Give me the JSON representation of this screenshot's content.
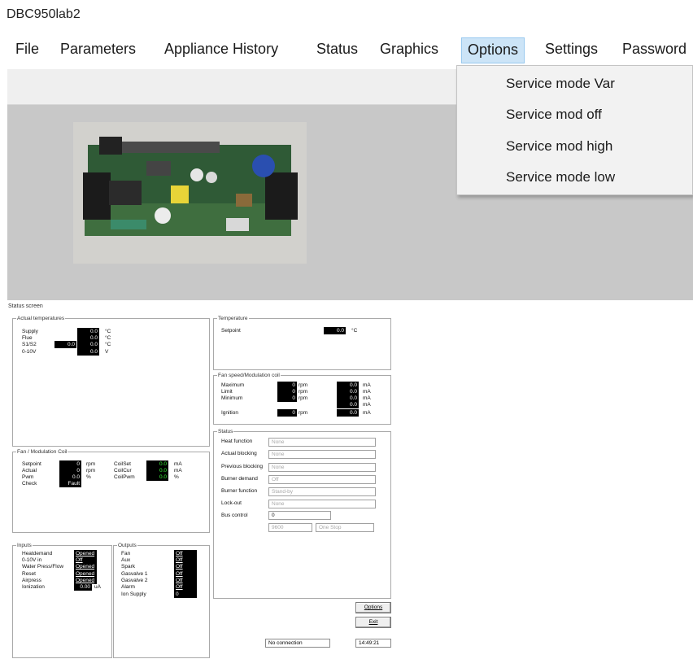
{
  "app": {
    "title": "DBC950lab2"
  },
  "menu": [
    "File",
    "Parameters",
    "Appliance History",
    "Status",
    "Graphics",
    "Options",
    "Settings",
    "Password"
  ],
  "options_menu": [
    "Service mode Var",
    "Service mod off",
    "Service mod high",
    "Service mode low"
  ],
  "status_screen": {
    "title": "Status screen",
    "actual_temperatures": {
      "label": "Actual temperatures",
      "rows": [
        {
          "label": "Supply",
          "value": "0.0",
          "unit": "°C"
        },
        {
          "label": "Flue",
          "value": "0.0",
          "unit": "°C"
        },
        {
          "label": "S1/S2",
          "value": "0.0",
          "unit": "°C",
          "extra": "0.0"
        },
        {
          "label": "0-10V",
          "value": "0.0",
          "unit": "V"
        }
      ]
    },
    "fan_modulation_coil": {
      "label": "Fan / Modulation Coil",
      "setpoint": {
        "label": "Setpoint",
        "value": "0",
        "unit": "rpm"
      },
      "actual": {
        "label": "Actual",
        "value": "0",
        "unit": "rpm"
      },
      "pwm": {
        "label": "Pwm",
        "value": "0.0",
        "unit": "%"
      },
      "check": {
        "label": "Check",
        "value": "Fault"
      },
      "coilset": {
        "label": "CoilSet",
        "value": "0.0",
        "unit": "mA"
      },
      "coilcur": {
        "label": "CoilCur",
        "value": "0.0",
        "unit": "mA"
      },
      "coilpwm": {
        "label": "CoilPwm",
        "value": "0.0",
        "unit": "%"
      }
    },
    "inputs": {
      "label": "Inputs",
      "rows": [
        {
          "label": "Heatdemand",
          "value": "Opened"
        },
        {
          "label": "0-10V in",
          "value": "Off"
        },
        {
          "label": "Water Press/Flow",
          "value": "Opened"
        },
        {
          "label": "Reset",
          "value": "Opened"
        },
        {
          "label": "Airpress",
          "value": "Opened"
        },
        {
          "label": "Ionization",
          "value": "0.00",
          "unit": "uA"
        }
      ]
    },
    "outputs": {
      "label": "Outputs",
      "rows": [
        {
          "label": "Fan",
          "value": "Off"
        },
        {
          "label": "Aux",
          "value": "Off"
        },
        {
          "label": "Spark",
          "value": "Off"
        },
        {
          "label": "Gasvalve 1",
          "value": "Off"
        },
        {
          "label": "Gasvalve 2",
          "value": "Off"
        },
        {
          "label": "Alarm",
          "value": "Off"
        },
        {
          "label": "Ion Supply",
          "value": "0"
        }
      ]
    },
    "temperature": {
      "label": "Temperature",
      "setpoint": {
        "label": "Setpoint",
        "value": "0.0",
        "unit": "°C"
      }
    },
    "fan_speed": {
      "label": "Fan speed/Modulation coil",
      "rows": [
        {
          "label": "Maximum",
          "rpm": "0",
          "rpm_unit": "rpm",
          "ma": "0.0",
          "ma_unit": "mA"
        },
        {
          "label": "Limit",
          "rpm": "0",
          "rpm_unit": "rpm",
          "ma": "0.0",
          "ma_unit": "mA"
        },
        {
          "label": "Minimum",
          "rpm": "0",
          "rpm_unit": "rpm",
          "ma": "0.0",
          "ma_unit": "mA"
        },
        {
          "label": "",
          "ma": "0.0",
          "ma_unit": "mA"
        },
        {
          "label": "Ignition",
          "rpm": "0",
          "rpm_unit": "rpm",
          "ma": "0.0",
          "ma_unit": "mA"
        }
      ]
    },
    "status": {
      "label": "Status",
      "rows": [
        {
          "label": "Heat function",
          "value": "None"
        },
        {
          "label": "Actual blocking",
          "value": "None"
        },
        {
          "label": "Previous blocking",
          "value": "None"
        },
        {
          "label": "Burner demand",
          "value": "Off"
        },
        {
          "label": "Burner function",
          "value": "Stand-by"
        },
        {
          "label": "Lock-out",
          "value": "None"
        }
      ],
      "bus_control": {
        "label": "Bus control",
        "value": "0"
      },
      "baud": "9600",
      "stop": "One Stop"
    },
    "buttons": {
      "options": "Options",
      "exit": "Exit"
    },
    "connection": "No connection",
    "clock": "14:49:21"
  },
  "colors": {
    "menu_highlight": "#cce4f7",
    "value_bg": "#000000",
    "value_green": "#3cff3c"
  }
}
